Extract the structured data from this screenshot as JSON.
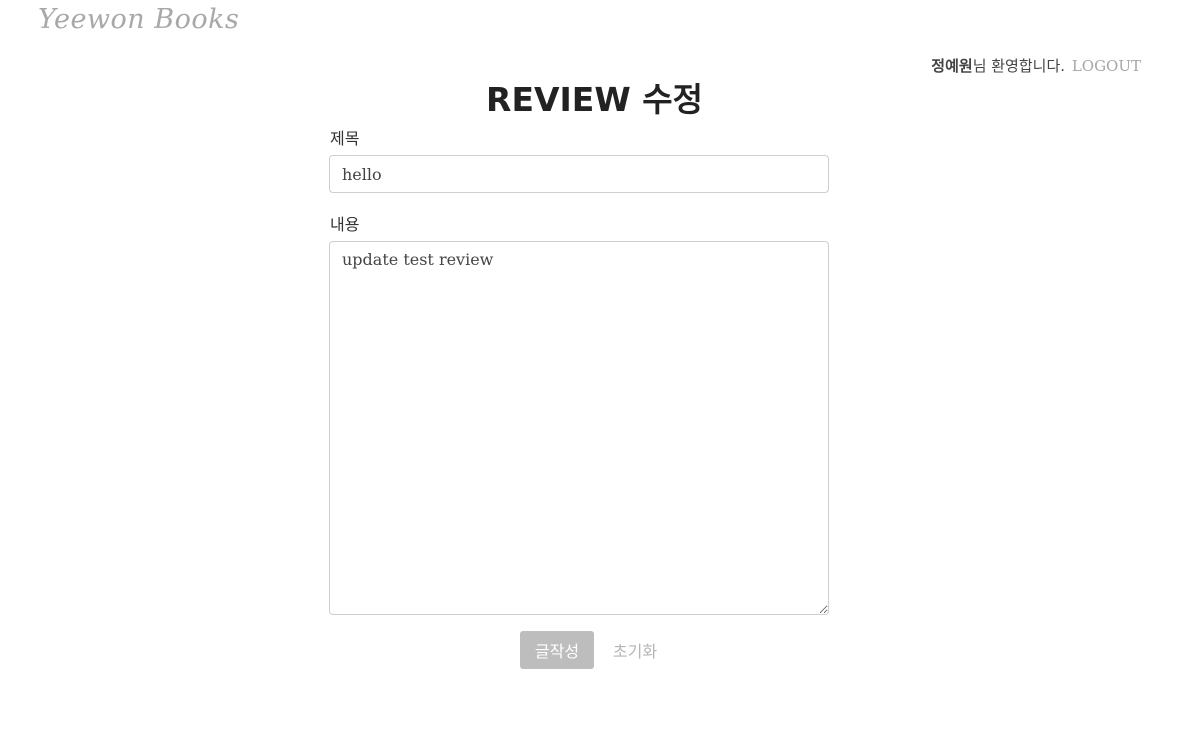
{
  "header": {
    "logo_text": "Yeewon Books",
    "user_name": "정예원",
    "welcome_suffix": "님 환영합니다.",
    "logout_label": "LOGOUT"
  },
  "page": {
    "title": "REVIEW 수정"
  },
  "form": {
    "title_label": "제목",
    "title_value": "hello",
    "content_label": "내용",
    "content_value": "update test review",
    "submit_label": "글작성",
    "reset_label": "초기화"
  }
}
